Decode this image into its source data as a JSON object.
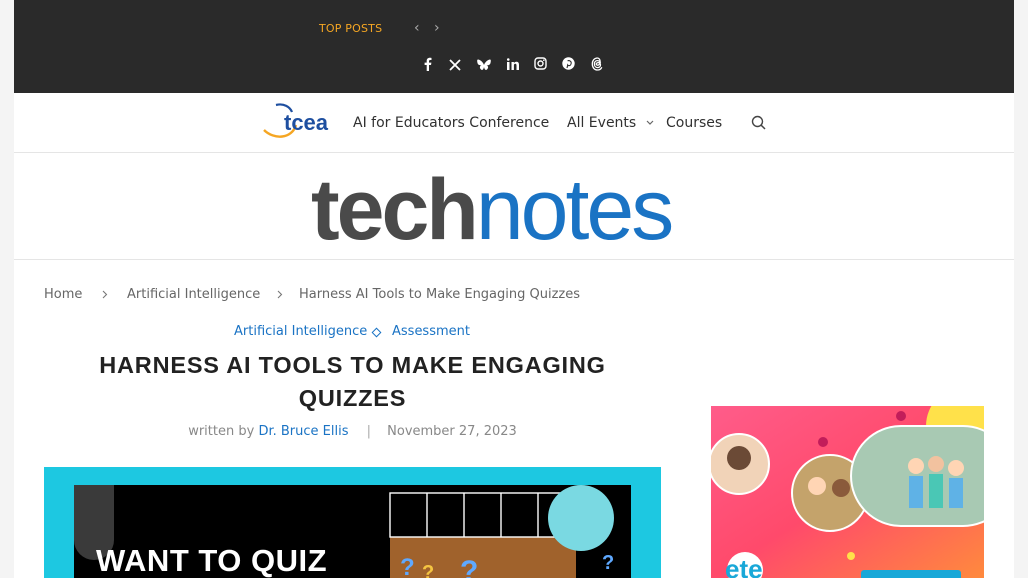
{
  "topbar": {
    "top_posts_label": "TOP POSTS",
    "prev_label": "‹",
    "next_label": "›",
    "social_icons": [
      "facebook-icon",
      "x-icon",
      "bluesky-icon",
      "linkedin-icon",
      "instagram-icon",
      "pinterest-icon",
      "threads-icon"
    ]
  },
  "nav": {
    "logo_text": "tcea",
    "links": [
      "AI for Educators Conference",
      "All Events",
      "Courses"
    ]
  },
  "brand": {
    "part1": "tech",
    "part2": "notes"
  },
  "breadcrumb": [
    "Home",
    "Artificial Intelligence",
    "Harness AI Tools to Make Engaging Quizzes"
  ],
  "article": {
    "categories": [
      "Artificial Intelligence",
      "Assessment"
    ],
    "title": "Harness AI Tools to Make Engaging Quizzes",
    "written_by": "written by",
    "author": "Dr. Bruce Ellis",
    "date": "November 27, 2023",
    "featured_text": "WANT TO QUIZ"
  },
  "colors": {
    "accent": "#1a73c4",
    "topbar_bg": "#2a2a2a",
    "top_posts": "#f5a623",
    "featured_bg": "#1dc8e1"
  }
}
